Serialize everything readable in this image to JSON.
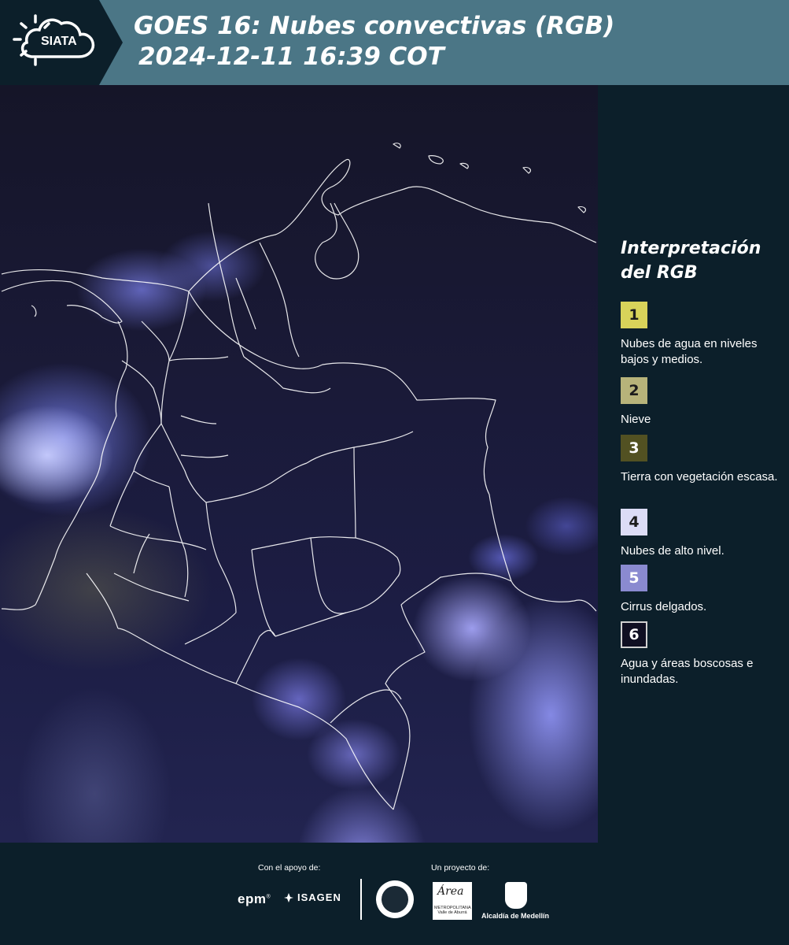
{
  "header": {
    "logo_text": "SIATA",
    "title_line1": "GOES 16: Nubes convectivas (RGB)",
    "title_line2": "2024-12-11 16:39 COT",
    "background_color": "#4b7686",
    "logo_panel_color": "#0c1f2a"
  },
  "map": {
    "product": "satellite-rgb-convective-clouds-image",
    "boundary_color": "#ffffff"
  },
  "legend": {
    "title_line1": "Interpretación",
    "title_line2": "del RGB",
    "items": [
      {
        "number": "1",
        "label": "Nubes de agua en niveles bajos y medios.",
        "color": "#d8d35a"
      },
      {
        "number": "2",
        "label": "Nieve",
        "color": "#b7b37a"
      },
      {
        "number": "3",
        "label": "Tierra con vegetación escasa.",
        "color": "#525122"
      },
      {
        "number": "4",
        "label": "Nubes de alto nivel.",
        "color": "#dcdcf6"
      },
      {
        "number": "5",
        "label": "Cirrus delgados.",
        "color": "#8a8ad0"
      },
      {
        "number": "6",
        "label": "Agua y áreas boscosas e inundadas.",
        "color": "#0f0f22"
      }
    ]
  },
  "footer": {
    "support_label": "Con el apoyo de:",
    "project_label": "Un proyecto de:",
    "sponsors": [
      "epm",
      "ISAGEN"
    ],
    "partners": [
      "Área Metropolitana Valle de Aburrá",
      "Alcaldía de Medellín"
    ],
    "epm_text": "epm",
    "isagen_text": "ISAGEN",
    "area_text": "Área",
    "area_subtext": "METROPOLITANA Valle de Aburrá",
    "alcaldia_text": "Alcaldía de Medellín"
  }
}
